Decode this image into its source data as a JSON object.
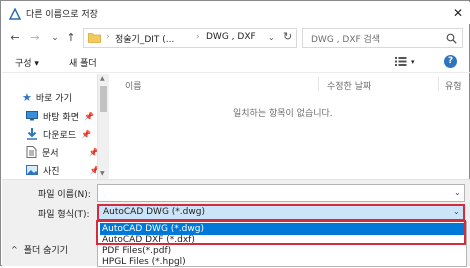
{
  "window": {
    "title": "다른 이름으로 저장",
    "close_label": "✕"
  },
  "nav": {
    "back": "←",
    "forward": "→",
    "dropdown": "⌄",
    "up": "↑"
  },
  "address": {
    "crumbs": [
      "정술기_DIT (...",
      "DWG , DXF"
    ],
    "separator": "›",
    "refresh": "↻"
  },
  "search": {
    "placeholder": "DWG , DXF 검색",
    "icon": "search-icon"
  },
  "toolbar": {
    "organize": "구성 ▾",
    "new_folder": "새 폴더",
    "help": "?"
  },
  "navpane": {
    "items": [
      {
        "label": "바로 가기",
        "icon": "star-icon"
      },
      {
        "label": "바탕 화면",
        "icon": "desktop-icon"
      },
      {
        "label": "다운로드",
        "icon": "download-icon"
      },
      {
        "label": "문서",
        "icon": "document-icon"
      },
      {
        "label": "사진",
        "icon": "picture-icon"
      }
    ]
  },
  "filelist": {
    "columns": [
      "이름",
      "수정한 날짜",
      "유형"
    ],
    "empty_message": "일치하는 항목이 없습니다."
  },
  "form": {
    "filename_label": "파일 이름(N):",
    "filename_value": "",
    "filetype_label": "파일 형식(T):",
    "filetype_value": "AutoCAD DWG (*.dwg)",
    "options": [
      "AutoCAD DWG (*.dwg)",
      "AutoCAD DXF (*.dxf)",
      "PDF Files(*.pdf)",
      "HPGL Files (*.hpgl)"
    ],
    "hide_folders": "폴더 숨기기"
  },
  "colors": {
    "accent": "#0078d7",
    "highlight_box": "#d42c3c",
    "selected_field": "#cce4f7"
  }
}
